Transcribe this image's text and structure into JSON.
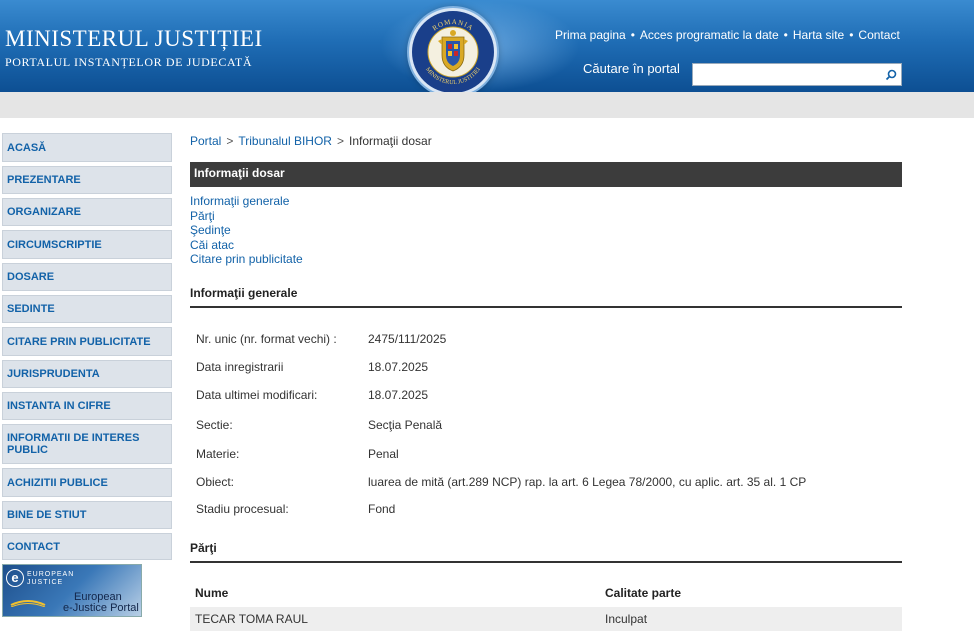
{
  "header": {
    "title": "MINISTERUL JUSTIȚIEI",
    "subtitle": "PORTALUL INSTANȚELOR DE JUDECATĂ",
    "emblem_top_text": "ROMANIA",
    "emblem_bottom_text": "MINISTERUL JUSTITIEI",
    "links": [
      "Prima pagina",
      "Acces programatic la date",
      "Harta site",
      "Contact"
    ],
    "link_separator": "•",
    "search_label": "Căutare în portal",
    "search_value": "",
    "search_icon": "search-icon"
  },
  "sidebar": {
    "items": [
      "ACASĂ",
      "PREZENTARE",
      "ORGANIZARE",
      "CIRCUMSCRIPTIE",
      "DOSARE",
      "SEDINTE",
      "CITARE PRIN PUBLICITATE",
      "JURISPRUDENTA",
      "INSTANTA IN CIFRE",
      "INFORMATII DE INTERES PUBLIC",
      "ACHIZITII PUBLICE",
      "BINE DE STIUT",
      "CONTACT"
    ],
    "banner": {
      "logo_letter": "e",
      "line1": "EUROPEAN",
      "line2": "JUSTICE",
      "portal_line1": "European",
      "portal_line2": "e-Justice Portal"
    }
  },
  "breadcrumb": {
    "items": [
      "Portal",
      "Tribunalul BIHOR",
      "Informaţii dosar"
    ],
    "separator": ">"
  },
  "main": {
    "section_title": "Informaţii dosar",
    "anchor_links": [
      "Informaţii generale",
      "Părţi",
      "Şedinţe",
      "Căi atac",
      "Citare prin publicitate"
    ],
    "general": {
      "heading": "Informaţii generale",
      "rows": [
        {
          "label": "Nr. unic (nr. format vechi) :",
          "value": "2475/111/2025"
        },
        {
          "label": "Data inregistrarii",
          "value": "18.07.2025"
        },
        {
          "label": "Data ultimei modificari:",
          "value": "18.07.2025"
        },
        {
          "label": "Sectie:",
          "value": "Secţia Penală"
        },
        {
          "label": "Materie:",
          "value": "Penal"
        },
        {
          "label": "Obiect:",
          "value": "luarea de mită (art.289 NCP) rap. la art. 6 Legea 78/2000, cu aplic. art. 35 al. 1 CP"
        },
        {
          "label": "Stadiu procesual:",
          "value": "Fond"
        }
      ]
    },
    "parti": {
      "heading": "Părţi",
      "columns": [
        "Nume",
        "Calitate parte"
      ],
      "rows": [
        [
          "TECAR TOMA RAUL",
          "Inculpat"
        ]
      ]
    }
  },
  "colors": {
    "header_top": "#3a8bd0",
    "header_bottom": "#0d4f93",
    "link": "#1262a8",
    "section_header_bg": "#3c3c3c",
    "nav_bg": "#dde3ea"
  }
}
